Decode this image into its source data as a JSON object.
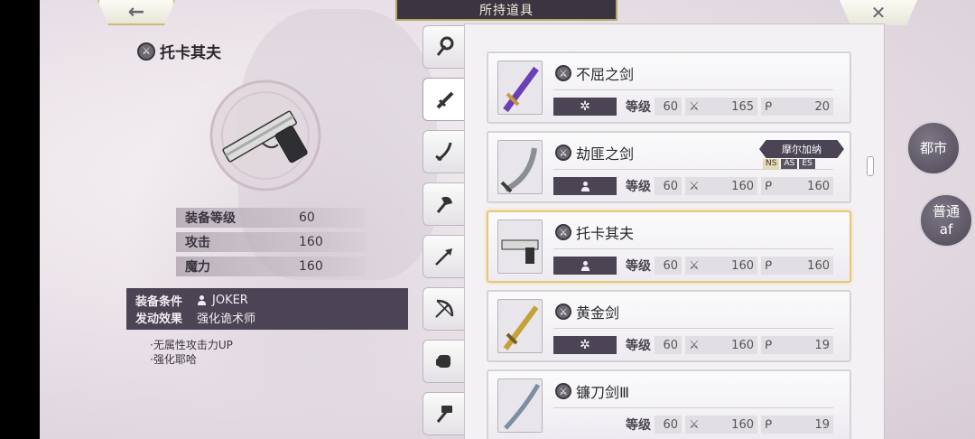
{
  "header": {
    "back_icon": "←",
    "title": "所持道具",
    "close_icon": "✕"
  },
  "detail": {
    "name": "托卡其夫",
    "stats": [
      {
        "label": "装备等级",
        "value": "60"
      },
      {
        "label": "攻击",
        "value": "160"
      },
      {
        "label": "魔力",
        "value": "160"
      }
    ],
    "condition_label": "装备条件",
    "condition_value": "JOKER",
    "effect_label": "发动效果",
    "effect_value": "强化诡术师",
    "effects": [
      "·无属性攻击力UP",
      "·强化耶哈"
    ]
  },
  "tabs": [
    {
      "icon": "staff-icon"
    },
    {
      "icon": "sword-icon",
      "active": true
    },
    {
      "icon": "saber-icon"
    },
    {
      "icon": "axe-icon"
    },
    {
      "icon": "spear-icon"
    },
    {
      "icon": "bow-icon"
    },
    {
      "icon": "fist-icon"
    },
    {
      "icon": "hammer-icon"
    }
  ],
  "list": [
    {
      "name": "不屈之剑",
      "restriction": "✲",
      "level_label": "等级",
      "level": "60",
      "atk": "165",
      "mag": "20"
    },
    {
      "name": "劫匪之剑",
      "restriction": "person",
      "level_label": "等级",
      "level": "60",
      "atk": "160",
      "mag": "160",
      "region": "摩尔加纳",
      "codes": [
        "NS",
        "AS",
        "ES"
      ]
    },
    {
      "name": "托卡其夫",
      "restriction": "person",
      "level_label": "等级",
      "level": "60",
      "atk": "160",
      "mag": "160",
      "selected": true
    },
    {
      "name": "黄金剑",
      "restriction": "✲",
      "level_label": "等级",
      "level": "60",
      "atk": "160",
      "mag": "19"
    },
    {
      "name": "镰刀剑Ⅲ",
      "restriction": "",
      "level_label": "等级",
      "level": "60",
      "atk": "160",
      "mag": "19"
    }
  ],
  "side": {
    "city_label": "都市",
    "mode_label": "普通",
    "mode_sub": "af"
  },
  "colors": {
    "dark_panel": "#4b4454",
    "gold_border": "#e6c77a"
  }
}
